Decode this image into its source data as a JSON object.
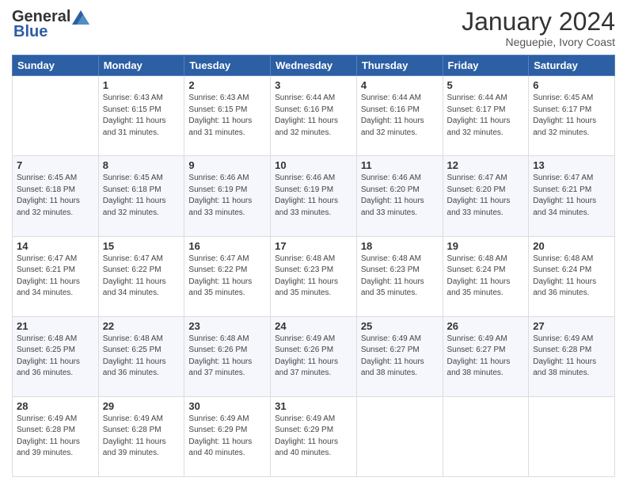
{
  "header": {
    "logo_general": "General",
    "logo_blue": "Blue",
    "month_title": "January 2024",
    "location": "Neguepie, Ivory Coast"
  },
  "weekdays": [
    "Sunday",
    "Monday",
    "Tuesday",
    "Wednesday",
    "Thursday",
    "Friday",
    "Saturday"
  ],
  "weeks": [
    [
      {
        "day": "",
        "sunrise": "",
        "sunset": "",
        "daylight": ""
      },
      {
        "day": "1",
        "sunrise": "Sunrise: 6:43 AM",
        "sunset": "Sunset: 6:15 PM",
        "daylight": "Daylight: 11 hours and 31 minutes."
      },
      {
        "day": "2",
        "sunrise": "Sunrise: 6:43 AM",
        "sunset": "Sunset: 6:15 PM",
        "daylight": "Daylight: 11 hours and 31 minutes."
      },
      {
        "day": "3",
        "sunrise": "Sunrise: 6:44 AM",
        "sunset": "Sunset: 6:16 PM",
        "daylight": "Daylight: 11 hours and 32 minutes."
      },
      {
        "day": "4",
        "sunrise": "Sunrise: 6:44 AM",
        "sunset": "Sunset: 6:16 PM",
        "daylight": "Daylight: 11 hours and 32 minutes."
      },
      {
        "day": "5",
        "sunrise": "Sunrise: 6:44 AM",
        "sunset": "Sunset: 6:17 PM",
        "daylight": "Daylight: 11 hours and 32 minutes."
      },
      {
        "day": "6",
        "sunrise": "Sunrise: 6:45 AM",
        "sunset": "Sunset: 6:17 PM",
        "daylight": "Daylight: 11 hours and 32 minutes."
      }
    ],
    [
      {
        "day": "7",
        "sunrise": "Sunrise: 6:45 AM",
        "sunset": "Sunset: 6:18 PM",
        "daylight": "Daylight: 11 hours and 32 minutes."
      },
      {
        "day": "8",
        "sunrise": "Sunrise: 6:45 AM",
        "sunset": "Sunset: 6:18 PM",
        "daylight": "Daylight: 11 hours and 32 minutes."
      },
      {
        "day": "9",
        "sunrise": "Sunrise: 6:46 AM",
        "sunset": "Sunset: 6:19 PM",
        "daylight": "Daylight: 11 hours and 33 minutes."
      },
      {
        "day": "10",
        "sunrise": "Sunrise: 6:46 AM",
        "sunset": "Sunset: 6:19 PM",
        "daylight": "Daylight: 11 hours and 33 minutes."
      },
      {
        "day": "11",
        "sunrise": "Sunrise: 6:46 AM",
        "sunset": "Sunset: 6:20 PM",
        "daylight": "Daylight: 11 hours and 33 minutes."
      },
      {
        "day": "12",
        "sunrise": "Sunrise: 6:47 AM",
        "sunset": "Sunset: 6:20 PM",
        "daylight": "Daylight: 11 hours and 33 minutes."
      },
      {
        "day": "13",
        "sunrise": "Sunrise: 6:47 AM",
        "sunset": "Sunset: 6:21 PM",
        "daylight": "Daylight: 11 hours and 34 minutes."
      }
    ],
    [
      {
        "day": "14",
        "sunrise": "Sunrise: 6:47 AM",
        "sunset": "Sunset: 6:21 PM",
        "daylight": "Daylight: 11 hours and 34 minutes."
      },
      {
        "day": "15",
        "sunrise": "Sunrise: 6:47 AM",
        "sunset": "Sunset: 6:22 PM",
        "daylight": "Daylight: 11 hours and 34 minutes."
      },
      {
        "day": "16",
        "sunrise": "Sunrise: 6:47 AM",
        "sunset": "Sunset: 6:22 PM",
        "daylight": "Daylight: 11 hours and 35 minutes."
      },
      {
        "day": "17",
        "sunrise": "Sunrise: 6:48 AM",
        "sunset": "Sunset: 6:23 PM",
        "daylight": "Daylight: 11 hours and 35 minutes."
      },
      {
        "day": "18",
        "sunrise": "Sunrise: 6:48 AM",
        "sunset": "Sunset: 6:23 PM",
        "daylight": "Daylight: 11 hours and 35 minutes."
      },
      {
        "day": "19",
        "sunrise": "Sunrise: 6:48 AM",
        "sunset": "Sunset: 6:24 PM",
        "daylight": "Daylight: 11 hours and 35 minutes."
      },
      {
        "day": "20",
        "sunrise": "Sunrise: 6:48 AM",
        "sunset": "Sunset: 6:24 PM",
        "daylight": "Daylight: 11 hours and 36 minutes."
      }
    ],
    [
      {
        "day": "21",
        "sunrise": "Sunrise: 6:48 AM",
        "sunset": "Sunset: 6:25 PM",
        "daylight": "Daylight: 11 hours and 36 minutes."
      },
      {
        "day": "22",
        "sunrise": "Sunrise: 6:48 AM",
        "sunset": "Sunset: 6:25 PM",
        "daylight": "Daylight: 11 hours and 36 minutes."
      },
      {
        "day": "23",
        "sunrise": "Sunrise: 6:48 AM",
        "sunset": "Sunset: 6:26 PM",
        "daylight": "Daylight: 11 hours and 37 minutes."
      },
      {
        "day": "24",
        "sunrise": "Sunrise: 6:49 AM",
        "sunset": "Sunset: 6:26 PM",
        "daylight": "Daylight: 11 hours and 37 minutes."
      },
      {
        "day": "25",
        "sunrise": "Sunrise: 6:49 AM",
        "sunset": "Sunset: 6:27 PM",
        "daylight": "Daylight: 11 hours and 38 minutes."
      },
      {
        "day": "26",
        "sunrise": "Sunrise: 6:49 AM",
        "sunset": "Sunset: 6:27 PM",
        "daylight": "Daylight: 11 hours and 38 minutes."
      },
      {
        "day": "27",
        "sunrise": "Sunrise: 6:49 AM",
        "sunset": "Sunset: 6:28 PM",
        "daylight": "Daylight: 11 hours and 38 minutes."
      }
    ],
    [
      {
        "day": "28",
        "sunrise": "Sunrise: 6:49 AM",
        "sunset": "Sunset: 6:28 PM",
        "daylight": "Daylight: 11 hours and 39 minutes."
      },
      {
        "day": "29",
        "sunrise": "Sunrise: 6:49 AM",
        "sunset": "Sunset: 6:28 PM",
        "daylight": "Daylight: 11 hours and 39 minutes."
      },
      {
        "day": "30",
        "sunrise": "Sunrise: 6:49 AM",
        "sunset": "Sunset: 6:29 PM",
        "daylight": "Daylight: 11 hours and 40 minutes."
      },
      {
        "day": "31",
        "sunrise": "Sunrise: 6:49 AM",
        "sunset": "Sunset: 6:29 PM",
        "daylight": "Daylight: 11 hours and 40 minutes."
      },
      {
        "day": "",
        "sunrise": "",
        "sunset": "",
        "daylight": ""
      },
      {
        "day": "",
        "sunrise": "",
        "sunset": "",
        "daylight": ""
      },
      {
        "day": "",
        "sunrise": "",
        "sunset": "",
        "daylight": ""
      }
    ]
  ]
}
